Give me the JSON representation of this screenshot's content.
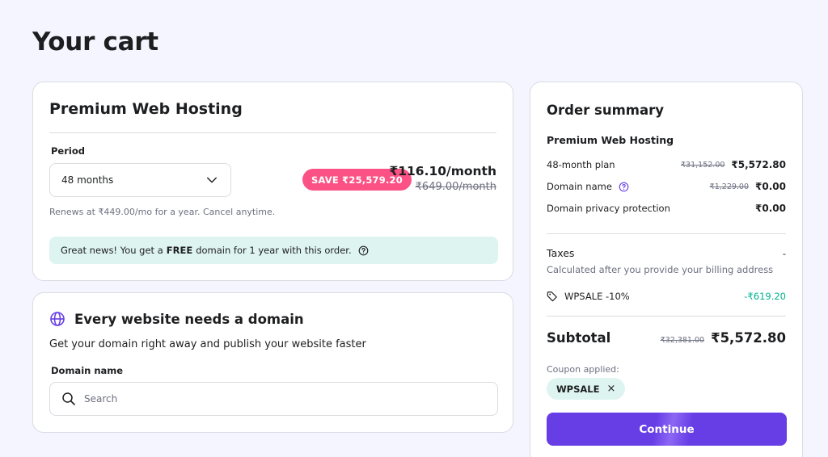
{
  "page": {
    "title": "Your cart"
  },
  "hosting": {
    "title": "Premium Web Hosting",
    "period_label": "Period",
    "period_value": "48 months",
    "save_badge": "SAVE ₹25,579.20",
    "price": "₹116.10/month",
    "old_price": "₹649.00/month",
    "renews": "Renews at ₹449.00/mo for a year. Cancel anytime.",
    "news_prefix": "Great news! You get a",
    "news_bold": "FREE",
    "news_suffix": "domain for 1 year with this order."
  },
  "domain": {
    "title": "Every website needs a domain",
    "subtitle": "Get your domain right away and publish your website faster",
    "field_label": "Domain name",
    "search_placeholder": "Search"
  },
  "summary": {
    "title": "Order summary",
    "product": "Premium Web Hosting",
    "lines": [
      {
        "label": "48-month plan",
        "old": "₹31,152.00",
        "value": "₹5,572.80"
      },
      {
        "label": "Domain name",
        "old": "₹1,229.00",
        "value": "₹0.00"
      },
      {
        "label": "Domain privacy protection",
        "old": "",
        "value": "₹0.00"
      }
    ],
    "taxes_label": "Taxes",
    "taxes_value": "-",
    "taxes_note": "Calculated after you provide your billing address",
    "coupon_line_label": "WPSALE -10%",
    "coupon_line_value": "-₹619.20",
    "subtotal_label": "Subtotal",
    "subtotal_old": "₹32,381.00",
    "subtotal_value": "₹5,572.80",
    "coupon_applied_label": "Coupon applied:",
    "coupon_code": "WPSALE",
    "coupon_remove": "×",
    "continue_label": "Continue"
  },
  "colors": {
    "background": "#f4f5ff",
    "primary": "#673de6",
    "save_badge": "#fc5185",
    "success_bg": "#def4f0",
    "discount_text": "#00b090"
  },
  "icons": [
    "chevron-down-icon",
    "help-icon",
    "globe-icon",
    "search-icon",
    "tag-icon",
    "close-icon"
  ]
}
